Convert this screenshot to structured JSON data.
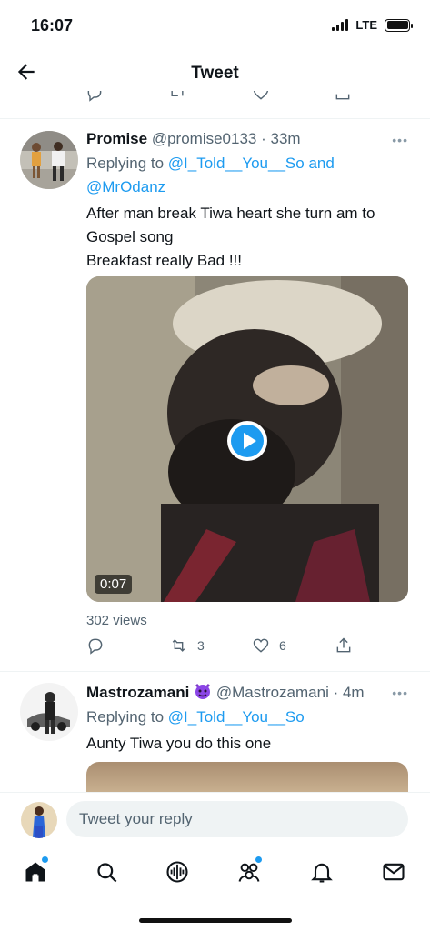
{
  "status_bar": {
    "time": "16:07",
    "network": "LTE"
  },
  "header": {
    "title": "Tweet"
  },
  "tweets": [
    {
      "name": "Promise",
      "handle": "@promise0133",
      "time": "· 33m",
      "replying_prefix": "Replying to",
      "mention_1": "@I_Told__You__So",
      "joiner": "and",
      "mention_2": "@MrOdanz",
      "text_line_1": "After man break Tiwa heart she turn am to Gospel song",
      "text_line_2": "Breakfast really Bad !!!",
      "video_duration": "0:07",
      "views": "302 views",
      "retweets": "3",
      "likes": "6"
    },
    {
      "name": "Mastrozamani",
      "handle": "@Mastrozamani",
      "time": "· 4m",
      "replying_prefix": "Replying to",
      "mention_1": "@I_Told__You__So",
      "text_line_1": "Aunty Tiwa you do this one"
    }
  ],
  "reply_box": {
    "placeholder": "Tweet your reply"
  },
  "bottom_nav": {
    "items": [
      {
        "icon": "home-icon",
        "notification_dot": true
      },
      {
        "icon": "search-icon",
        "notification_dot": false
      },
      {
        "icon": "spaces-icon",
        "notification_dot": false
      },
      {
        "icon": "communities-icon",
        "notification_dot": true
      },
      {
        "icon": "notifications-icon",
        "notification_dot": false
      },
      {
        "icon": "messages-icon",
        "notification_dot": false
      }
    ]
  },
  "colors": {
    "accent": "#1d9bf0",
    "secondary_text": "#536471",
    "border": "#eff3f4"
  }
}
